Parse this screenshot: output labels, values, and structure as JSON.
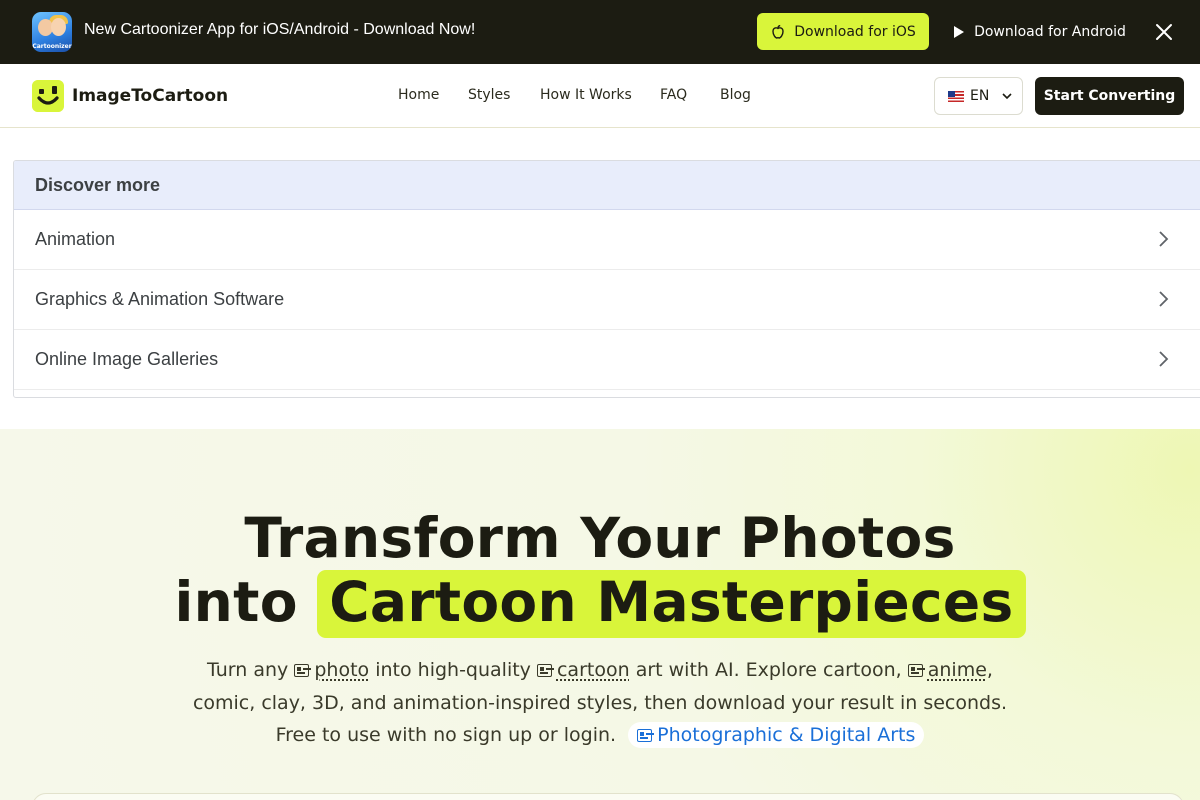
{
  "promo": {
    "app_icon_label": "Cartoonizer",
    "text": "New Cartoonizer App for iOS/Android - Download Now!",
    "ios_label": "Download for iOS",
    "android_label": "Download for Android"
  },
  "nav": {
    "logo_text": "ImageToCartoon",
    "links": [
      "Home",
      "Styles",
      "How It Works",
      "FAQ",
      "Blog"
    ],
    "lang": "EN",
    "cta": "Start Converting"
  },
  "discover": {
    "title": "Discover more",
    "items": [
      "Animation",
      "Graphics & Animation Software",
      "Online Image Galleries"
    ]
  },
  "hero": {
    "title_line1": "Transform Your Photos",
    "title_line2_prefix": "into",
    "title_highlight": "Cartoon Masterpieces",
    "sub_1": "Turn any",
    "link_photo": "photo",
    "sub_2": "into high-quality",
    "link_cartoon": "cartoon",
    "sub_3": "art with AI. Explore cartoon,",
    "link_anime": "anime",
    "sub_4": ",",
    "line2": "comic, clay, 3D, and animation-inspired styles, then download your result in seconds.",
    "line3": "Free to use with no sign up or login.",
    "chip_label": "Photographic & Digital Arts"
  },
  "colors": {
    "accent": "#d9f53a",
    "dark": "#1c1c12",
    "link_blue": "#1a6fd8"
  }
}
